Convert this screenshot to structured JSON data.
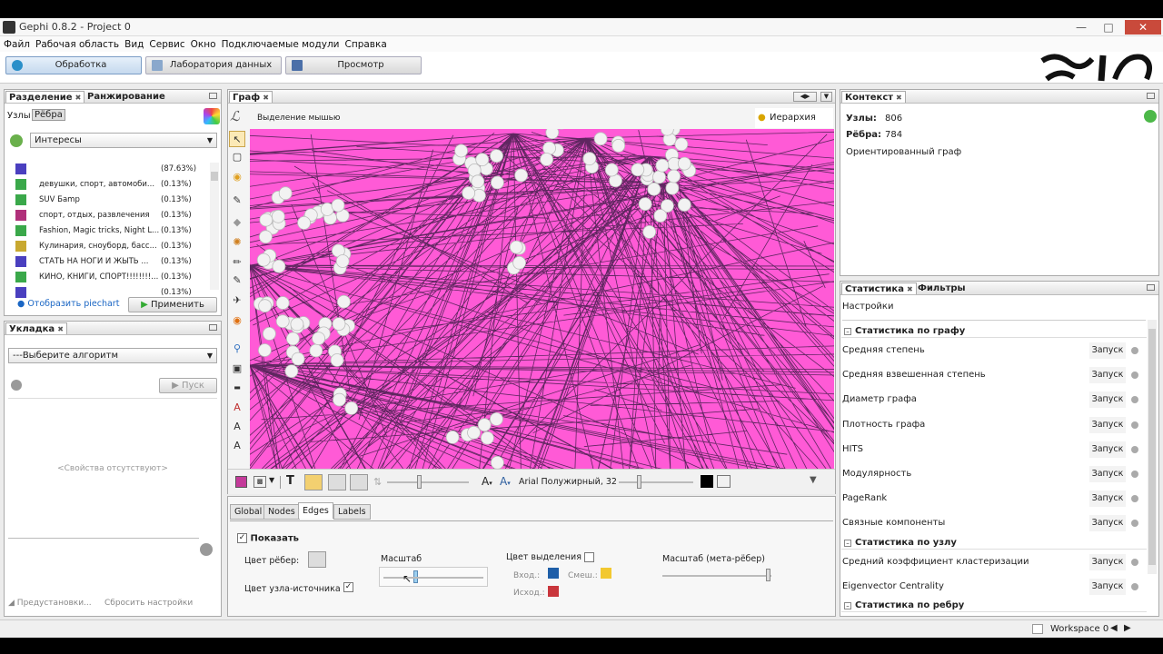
{
  "window": {
    "title": "Gephi 0.8.2 - Project 0"
  },
  "menu": [
    "Файл",
    "Рабочая область",
    "Вид",
    "Сервис",
    "Окно",
    "Подключаемые модули",
    "Справка"
  ],
  "modes": [
    {
      "label": "Обработка",
      "active": true,
      "icon": "globe-icon"
    },
    {
      "label": "Лаборатория данных",
      "active": false,
      "icon": "table-icon"
    },
    {
      "label": "Просмотр",
      "active": false,
      "icon": "monitor-icon"
    }
  ],
  "partition": {
    "tabs": [
      "Разделение",
      "Ранжирование"
    ],
    "subtabs": [
      "Узлы",
      "Рёбра"
    ],
    "selected_attribute": "Интересы",
    "legend": [
      {
        "color": "#4a3fbf",
        "label": "",
        "pct": "(87.63%)"
      },
      {
        "color": "#3aa84a",
        "label": "девушки, спорт, автомоби...",
        "pct": "(0.13%)"
      },
      {
        "color": "#3aa84a",
        "label": "SUV Бamp",
        "pct": "(0.13%)"
      },
      {
        "color": "#b0307a",
        "label": "спорт, отдых, развлечения",
        "pct": "(0.13%)"
      },
      {
        "color": "#3aa84a",
        "label": "Fashion, Magic tricks, Night L...",
        "pct": "(0.13%)"
      },
      {
        "color": "#c8a830",
        "label": "Кулинария, сноуборд, басс...",
        "pct": "(0.13%)"
      },
      {
        "color": "#4a3fbf",
        "label": "СТАТЬ НА НОГИ И ЖЫТЬ ...",
        "pct": "(0.13%)"
      },
      {
        "color": "#3aa84a",
        "label": "КИНО, КНИГИ, СПОРТ!!!!!!!!...",
        "pct": "(0.13%)"
      },
      {
        "color": "#4a3fbf",
        "label": "",
        "pct": "(0.13%)"
      }
    ],
    "piechart_link": "Отобразить piechart",
    "apply_label": "Применить"
  },
  "layout": {
    "tab": "Укладка",
    "algorithm_placeholder": "---Выберите алгоритм",
    "run_label": "Пуск",
    "no_props": "<Свойства отсутствуют>",
    "presets": "Предустановки...",
    "reset": "Сбросить настройки"
  },
  "graph": {
    "tab": "Граф",
    "selection_mode": "Выделение мышью",
    "hierarchy": "Иерархия",
    "background_color": "#ff5ad6",
    "font_label": "Arial Полужирный, 32"
  },
  "edges_panel": {
    "tabs": [
      "Global",
      "Nodes",
      "Edges",
      "Labels"
    ],
    "active_tab": "Edges",
    "show_label": "Показать",
    "edge_color_label": "Цвет рёбер:",
    "source_color_label": "Цвет узла-источника",
    "scale_label": "Масштаб",
    "selection_color_label": "Цвет выделения",
    "in_label": "Вход.:",
    "mixed_label": "Смеш.:",
    "out_label": "Исход.:",
    "meta_scale_label": "Масштаб (мета-рёбер)",
    "in_color": "#1f5fa8",
    "mixed_color": "#f2c830",
    "out_color": "#c9363c",
    "scale_value": 0.3
  },
  "context": {
    "tab": "Контекст",
    "nodes_label": "Узлы:",
    "nodes_value": "806",
    "edges_label": "Рёбра:",
    "edges_value": "784",
    "graph_type": "Ориентированный граф"
  },
  "statistics": {
    "tabs": [
      "Статистика",
      "Фильтры"
    ],
    "settings": "Настройки",
    "run_label": "Запуск",
    "sections": [
      {
        "title": "Статистика по графу",
        "items": [
          "Средняя степень",
          "Средняя взвешенная степень",
          "Диаметр графа",
          "Плотность графа",
          "HITS",
          "Модулярность",
          "PageRank",
          "Связные компоненты"
        ]
      },
      {
        "title": "Статистика по узлу",
        "items": [
          "Средний коэффициент кластеризации",
          "Eigenvector Centrality"
        ]
      },
      {
        "title": "Статистика по ребру",
        "items": []
      }
    ]
  },
  "status": {
    "workspace": "Workspace 0"
  }
}
